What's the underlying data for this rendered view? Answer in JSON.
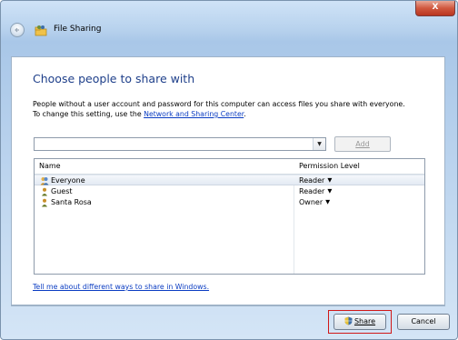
{
  "window": {
    "title": "File Sharing",
    "close_label": "X"
  },
  "main": {
    "heading": "Choose people to share with",
    "description_line1": "People without a user account and password for this computer can access files you share with everyone.",
    "description_line2_prefix": "To change this setting, use the ",
    "network_link": "Network and Sharing Center",
    "description_line2_suffix": ".",
    "name_input_value": "",
    "add_button": "Add",
    "columns": {
      "name": "Name",
      "permission": "Permission Level"
    },
    "users": [
      {
        "name": "Everyone",
        "permission": "Reader",
        "icon": "users-group-icon"
      },
      {
        "name": "Guest",
        "permission": "Reader",
        "icon": "user-icon"
      },
      {
        "name": "Santa Rosa",
        "permission": "Owner",
        "icon": "user-icon"
      }
    ],
    "help_link": "Tell me about different ways to share in Windows."
  },
  "footer": {
    "share_button": "Share",
    "cancel_button": "Cancel"
  },
  "colors": {
    "heading": "#1e3f8a",
    "link": "#0a3cc2",
    "highlight": "#d11818"
  }
}
